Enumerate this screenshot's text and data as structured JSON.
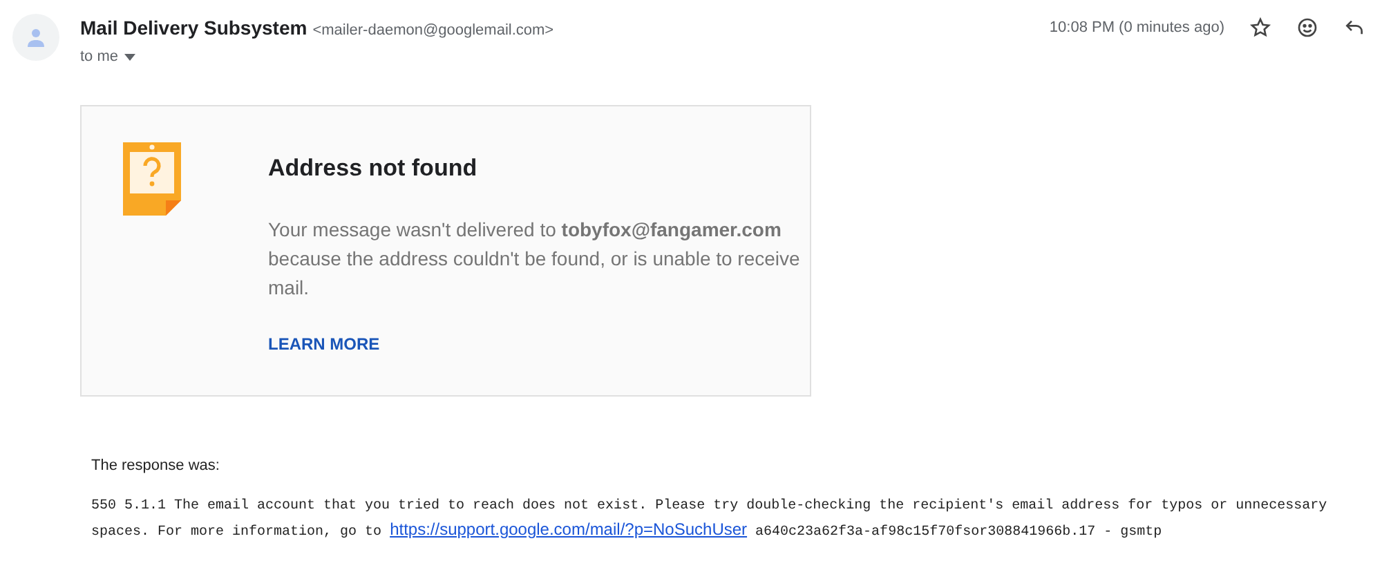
{
  "header": {
    "sender_name": "Mail Delivery Subsystem",
    "sender_email": "<mailer-daemon@googlemail.com>",
    "recipient": "to me",
    "time": "10:08 PM (0 minutes ago)"
  },
  "notice": {
    "title": "Address not found",
    "message": "Your message wasn't delivered to **tobyfox@fangamer.com** because the address couldn't be found, or is unable to receive mail.",
    "link": "LEARN MORE"
  },
  "response": {
    "label": "The response was:",
    "text_before": "550 5.1.1 The email account that you tried to reach does not exist. Please try double-checking the recipient's email address for typos or unnecessary spaces. For more information, go to",
    "link": "https://support.google.com/mail/?p=NoSuchUser",
    "text_after": "a640c23a62f3a-af98c15f70fsor308841966b.17 - gsmtp"
  }
}
